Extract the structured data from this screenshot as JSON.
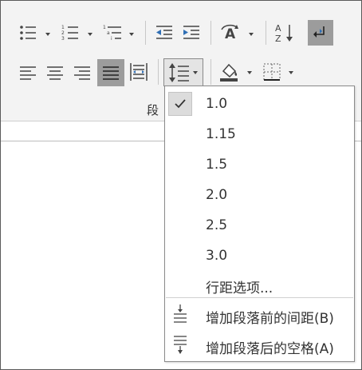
{
  "ribbon": {
    "group_label": "段",
    "row1": [
      {
        "icon": "bullets-icon",
        "has_dropdown": true
      },
      {
        "icon": "numbering-icon",
        "has_dropdown": true
      },
      {
        "icon": "multilevel-list-icon",
        "has_dropdown": true
      },
      {
        "icon": "decrease-indent-icon",
        "has_dropdown": false
      },
      {
        "icon": "increase-indent-icon",
        "has_dropdown": false
      },
      {
        "icon": "chinese-layout-icon",
        "has_dropdown": true
      },
      {
        "icon": "sort-icon",
        "has_dropdown": false
      },
      {
        "icon": "show-paragraph-marks-icon",
        "has_dropdown": false,
        "selected": true
      }
    ],
    "row2": [
      {
        "icon": "align-left-icon"
      },
      {
        "icon": "align-center-icon"
      },
      {
        "icon": "align-right-icon"
      },
      {
        "icon": "justify-icon",
        "selected": true
      },
      {
        "icon": "distributed-icon"
      },
      {
        "icon": "line-spacing-icon",
        "has_dropdown": true,
        "open": true
      },
      {
        "icon": "shading-icon",
        "has_dropdown": true
      },
      {
        "icon": "borders-icon",
        "has_dropdown": true
      }
    ]
  },
  "line_spacing_menu": {
    "options": [
      {
        "label": "1.0",
        "checked": true
      },
      {
        "label": "1.15",
        "checked": false
      },
      {
        "label": "1.5",
        "checked": false
      },
      {
        "label": "2.0",
        "checked": false
      },
      {
        "label": "2.5",
        "checked": false
      },
      {
        "label": "3.0",
        "checked": false
      }
    ],
    "more_options": "行距选项...",
    "add_space_before": "增加段落前的间距(B)",
    "add_space_after": "增加段落后的空格(A)"
  },
  "colors": {
    "ribbon_bg": "#f3f3f3",
    "selected_bg": "#9c9c9c",
    "menu_check_bg": "#dcdcdc"
  }
}
